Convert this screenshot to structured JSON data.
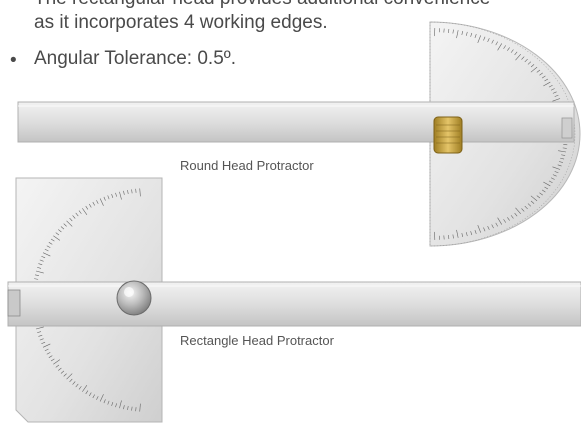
{
  "text": {
    "line1": "The rectangular head provides additional convenience",
    "line2": "as it incorporates 4 working edges.",
    "bullet_marker": "•",
    "bullet_text": "Angular Tolerance: 0.5º."
  },
  "captions": {
    "round": "Round Head Protractor",
    "rectangle": "Rectangle Head Protractor"
  },
  "colors": {
    "steel_light": "#eeeeee",
    "steel_mid": "#d2d2d2",
    "steel_dark": "#b5b5b5",
    "brass": "#c9a441",
    "scale_text": "#555555"
  }
}
